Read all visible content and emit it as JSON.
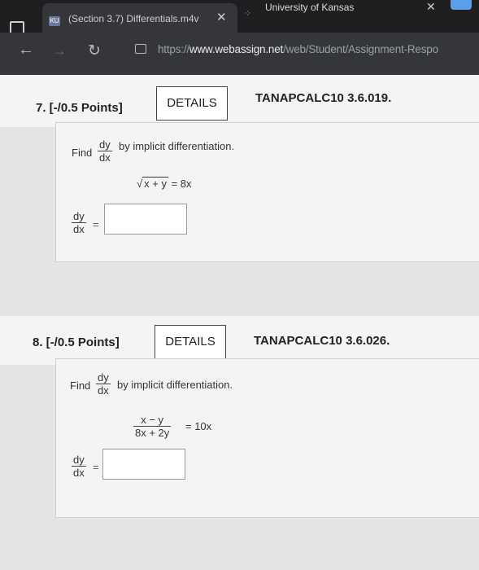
{
  "browser": {
    "active_tab_title": "(Section 3.7) Differentials.m4v",
    "active_tab_favicon": "KU",
    "second_tab_title": "University of Kansas",
    "url_scheme": "https://",
    "url_host": "www.webassign.net",
    "url_path": "/web/Student/Assignment-Respo"
  },
  "questions": [
    {
      "number": "7. [-/0.5 Points]",
      "details_label": "DETAILS",
      "course_code": "TANAPCALC10 3.6.019.",
      "find_prefix": "Find",
      "deriv_num": "dy",
      "deriv_den": "dx",
      "find_suffix": "by implicit differentiation.",
      "equation_radicand": "x + y",
      "equation_rhs": "= 8x",
      "answer_label_num": "dy",
      "answer_label_den": "dx",
      "answer_eq": "=",
      "answer_value": ""
    },
    {
      "number": "8. [-/0.5 Points]",
      "details_label": "DETAILS",
      "course_code": "TANAPCALC10 3.6.026.",
      "find_prefix": "Find",
      "deriv_num": "dy",
      "deriv_den": "dx",
      "find_suffix": "by implicit differentiation.",
      "equation_num": "x − y",
      "equation_den": "8x + 2y",
      "equation_rhs": "= 10x",
      "answer_label_num": "dy",
      "answer_label_den": "dx",
      "answer_eq": "=",
      "answer_value": ""
    }
  ]
}
